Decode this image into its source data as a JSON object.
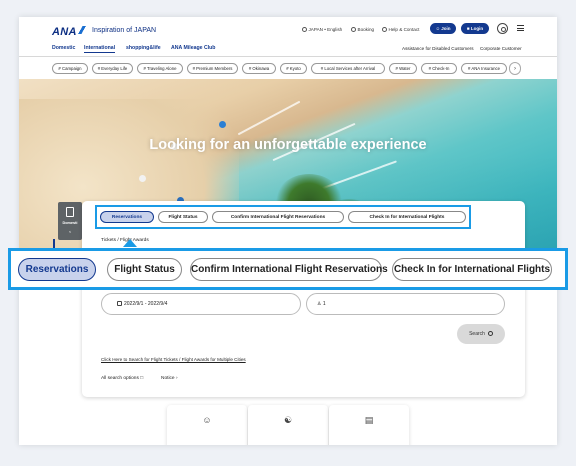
{
  "header": {
    "logo": "ANA",
    "tagline": "Inspiration of JAPAN",
    "language": "JAPAN • English",
    "booking": "Booking",
    "help": "Help & Contact",
    "join": "Join",
    "login": "Login"
  },
  "nav": {
    "items": [
      "Domestic",
      "International",
      "shopping&life",
      "ANA Mileage Club"
    ],
    "active": "International",
    "right_links": [
      "Assistance for Disabled Customers",
      "Corporate Customer"
    ]
  },
  "tags": [
    "# Campaign",
    "# Everyday Life",
    "# Traveling Alone",
    "# Premium Members",
    "# Okinawa",
    "# Kyoto",
    "# Local Services after Arrival",
    "# Water",
    "# Check-In",
    "# ANA Insurance"
  ],
  "hero": {
    "title": "Looking for an unforgettable experience"
  },
  "side_tab": {
    "label": "Domesti",
    "arrow": "<"
  },
  "booking_tabs": {
    "items": [
      "Reservations",
      "Flight Status",
      "Confirm International Flight Reservations",
      "Check In for International Flights"
    ],
    "selected": "Reservations"
  },
  "sub_tabs": {
    "label": "Tickets  /  Flight Awards"
  },
  "form": {
    "dates": "2022/9/1 - 2022/9/4",
    "passengers": "1",
    "search_button": "Search",
    "multi_city_link": "Click Here to Search for Flight Tickets / Flight Awards for Multiple Cities",
    "all_search_options": "All search options",
    "notice": "Notice"
  },
  "colors": {
    "brand_navy": "#13398f",
    "highlight_blue": "#1a9be6",
    "selected_tab_bg": "#c8d2ec"
  }
}
